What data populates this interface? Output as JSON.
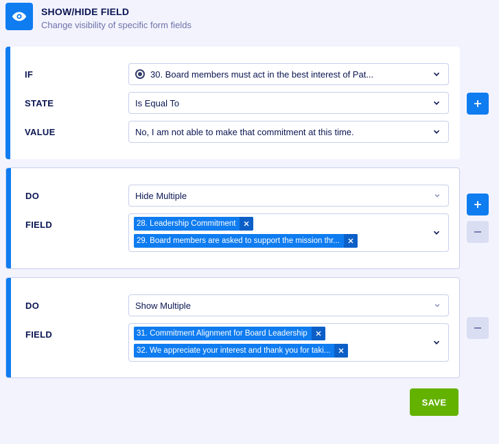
{
  "header": {
    "icon": "eye-icon",
    "title": "SHOW/HIDE FIELD",
    "subtitle": "Change visibility of specific form fields"
  },
  "condition": {
    "if_label": "IF",
    "if_value": "30. Board members must act in the best interest of Pat...",
    "state_label": "STATE",
    "state_value": "Is Equal To",
    "value_label": "VALUE",
    "value_value": "No, I am not able to make that commitment at this time."
  },
  "actions": [
    {
      "do_label": "DO",
      "do_value": "Hide Multiple",
      "field_label": "FIELD",
      "fields": [
        "28. Leadership Commitment",
        "29. Board members are asked to support the mission thr..."
      ]
    },
    {
      "do_label": "DO",
      "do_value": "Show Multiple",
      "field_label": "FIELD",
      "fields": [
        "31. Commitment Alignment for Board Leadership",
        "32. We appreciate your interest and thank you for taki..."
      ]
    }
  ],
  "buttons": {
    "save_label": "SAVE",
    "add_icon": "plus-icon",
    "remove_icon": "minus-icon"
  },
  "colors": {
    "accent": "#0f7cf0",
    "save": "#64b200",
    "background": "#f3f3fe",
    "text": "#0a1551"
  }
}
